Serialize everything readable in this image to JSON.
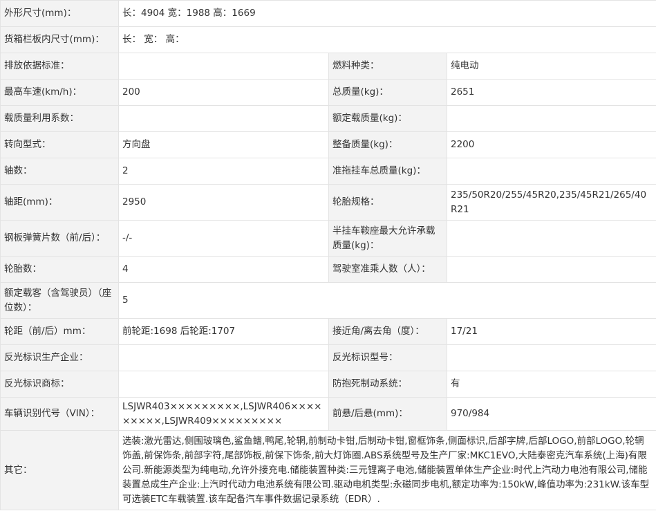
{
  "rows": [
    {
      "label": "外形尺寸(mm)：",
      "value": "长：4904 宽：1988 高：1669"
    },
    {
      "label": "货箱栏板内尺寸(mm)：",
      "value": "长： 宽： 高："
    },
    {
      "label": "排放依据标准：",
      "value": "",
      "label2": "燃料种类：",
      "value2": "纯电动"
    },
    {
      "label": "最高车速(km/h)：",
      "value": "200",
      "label2": "总质量(kg)：",
      "value2": "2651"
    },
    {
      "label": "载质量利用系数：",
      "value": "",
      "label2": "额定载质量(kg)：",
      "value2": ""
    },
    {
      "label": "转向型式：",
      "value": "方向盘",
      "label2": "整备质量(kg)：",
      "value2": "2200"
    },
    {
      "label": "轴数：",
      "value": "2",
      "label2": "准拖挂车总质量(kg)：",
      "value2": ""
    },
    {
      "label": "轴距(mm)：",
      "value": "2950",
      "label2": "轮胎规格：",
      "value2": "235/50R20/255/45R20,235/45R21/265/40R21"
    },
    {
      "label": "钢板弹簧片数（前/后）：",
      "value": "-/-",
      "label2": "半挂车鞍座最大允许承载质量(kg)：",
      "value2": ""
    },
    {
      "label": "轮胎数：",
      "value": "4",
      "label2": "驾驶室准乘人数（人）：",
      "value2": ""
    },
    {
      "label": "额定载客（含驾驶员）（座位数）：",
      "value": "5"
    },
    {
      "label": "轮距（前/后）mm：",
      "value": "前轮距:1698 后轮距:1707",
      "label2": "接近角/离去角（度）：",
      "value2": "17/21"
    },
    {
      "label": "反光标识生产企业：",
      "value": "",
      "label2": "反光标识型号：",
      "value2": ""
    },
    {
      "label": "反光标识商标：",
      "value": "",
      "label2": "防抱死制动系统：",
      "value2": "有"
    },
    {
      "label": "车辆识别代号（VIN）：",
      "value": "LSJWR403×××××××××,LSJWR406×××××××××,LSJWR409×××××××××",
      "label2": "前悬/后悬(mm)：",
      "value2": "970/984"
    },
    {
      "label": "其它：",
      "value": "选装:激光雷达,侧围玻璃色,鲨鱼鳍,鸭尾,轮辋,前制动卡钳,后制动卡钳,窗框饰条,侧面标识,后部字牌,后部LOGO,前部LOGO,轮辋饰盖,前保饰条,前部字符,尾部饰板,前保下饰条,前大灯饰圈.ABS系统型号及生产厂家:MKC1EVO,大陆泰密克汽车系统(上海)有限公司.新能源类型为纯电动,允许外接充电.储能装置种类:三元锂离子电池,储能装置单体生产企业:时代上汽动力电池有限公司,储能装置总成生产企业:上汽时代动力电池系统有限公司.驱动电机类型:永磁同步电机,额定功率为:150kW,峰值功率为:231kW.该车型可选装ETC车载装置.该车配备汽车事件数据记录系统（EDR）."
    }
  ]
}
